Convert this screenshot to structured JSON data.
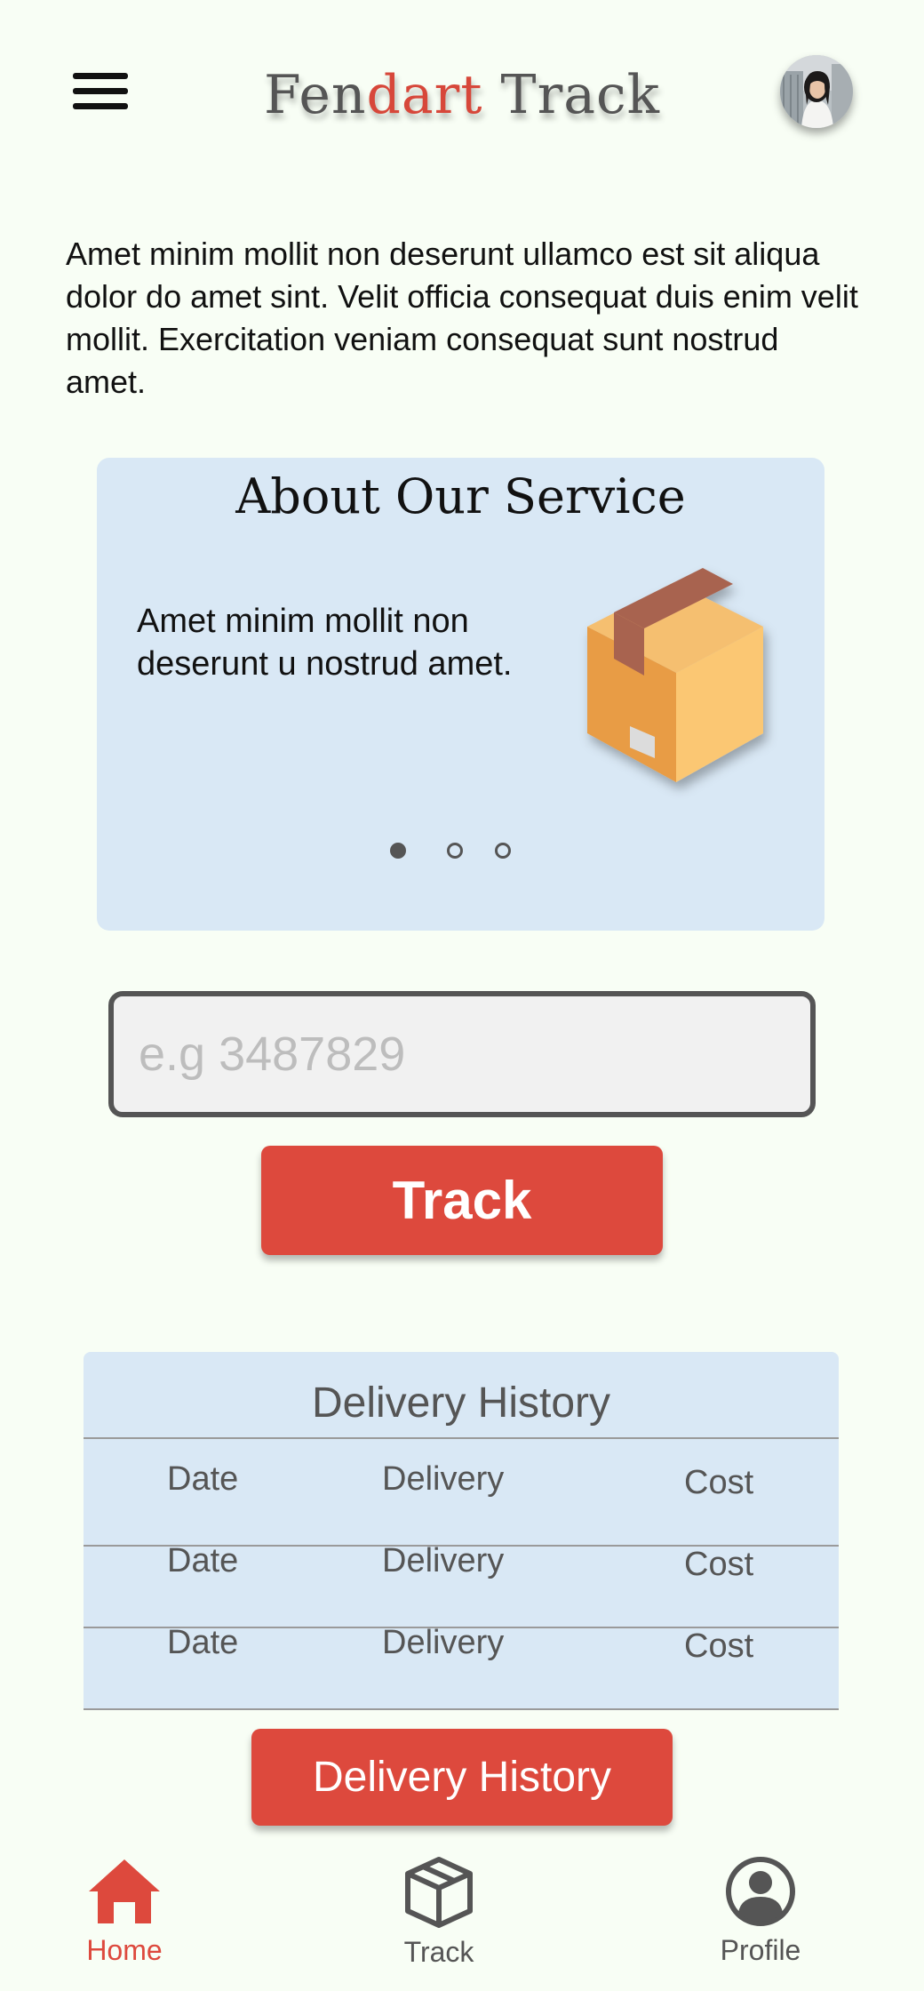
{
  "header": {
    "logo_part1": "Fen",
    "logo_accent": "dart",
    "logo_part2": " Track",
    "accent_color": "#d7473a"
  },
  "intro": {
    "text": "Amet minim mollit non deserunt ullamco est sit aliqua dolor do amet sint. Velit officia consequat duis enim velit mollit. Exercitation veniam consequat sunt nostrud amet."
  },
  "service": {
    "title": "About Our Service",
    "text": "Amet minim mollit non deserunt u nostrud amet.",
    "image_icon": "package-box-icon",
    "carousel_active_index": 0,
    "carousel_count": 3
  },
  "tracking": {
    "placeholder": "e.g 3487829",
    "value": "",
    "button_label": "Track"
  },
  "history": {
    "title": "Delivery History",
    "rows": [
      {
        "date": "Date",
        "delivery": "Delivery",
        "cost": "Cost"
      },
      {
        "date": "Date",
        "delivery": "Delivery",
        "cost": "Cost"
      },
      {
        "date": "Date",
        "delivery": "Delivery",
        "cost": "Cost"
      }
    ],
    "button_label": "Delivery History"
  },
  "nav": {
    "items": [
      {
        "label": "Home",
        "icon": "home-icon",
        "active": true
      },
      {
        "label": "Track",
        "icon": "box-icon",
        "active": false
      },
      {
        "label": "Profile",
        "icon": "user-circle-icon",
        "active": false
      }
    ],
    "active_color": "#dd493d"
  }
}
